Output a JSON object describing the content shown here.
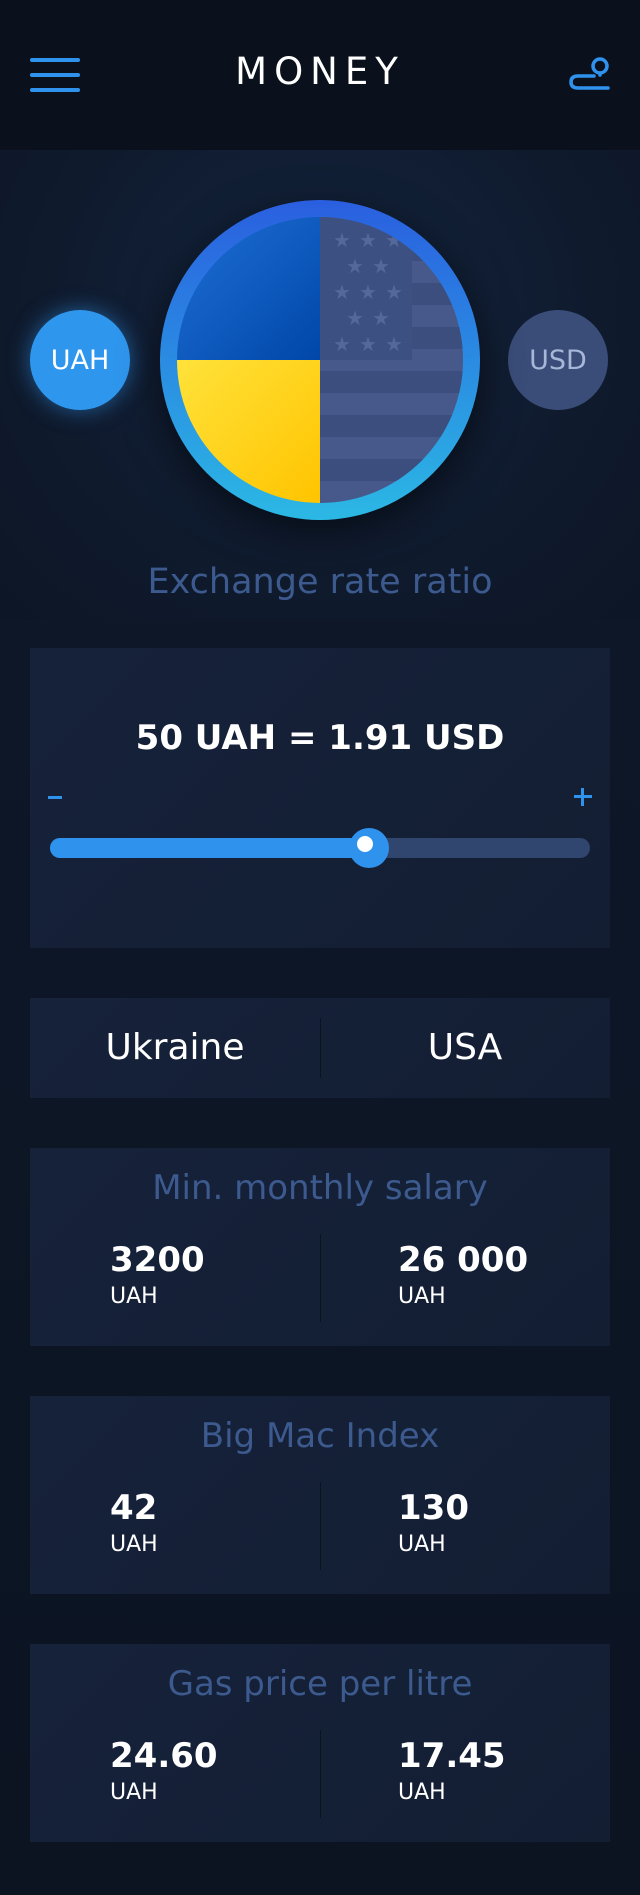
{
  "header": {
    "title": "MONEY"
  },
  "currencies": {
    "from": "UAH",
    "to": "USD"
  },
  "exchange": {
    "label": "Exchange rate ratio",
    "rate_text": "50 UAH = 1.91 USD",
    "slider_level": 0.59
  },
  "countries": {
    "left": "Ukraine",
    "right": "USA"
  },
  "stats": [
    {
      "title": "Min. monthly salary",
      "left_value": "3200",
      "left_unit": "UAH",
      "right_value": "26 000",
      "right_unit": "UAH"
    },
    {
      "title": "Big Mac Index",
      "left_value": "42",
      "left_unit": "UAH",
      "right_value": "130",
      "right_unit": "UAH"
    },
    {
      "title": "Gas price per litre",
      "left_value": "24.60",
      "left_unit": "UAH",
      "right_value": "17.45",
      "right_unit": "UAH"
    }
  ],
  "colors": {
    "accent": "#2f93ee",
    "muted_label": "#3c5a8e",
    "ukraine_blue": "#0057b8",
    "ukraine_yellow": "#ffd700",
    "usd_button": "#3a4d78"
  },
  "icons": {
    "menu": "hamburger-menu-icon",
    "route": "route-pin-icon"
  }
}
